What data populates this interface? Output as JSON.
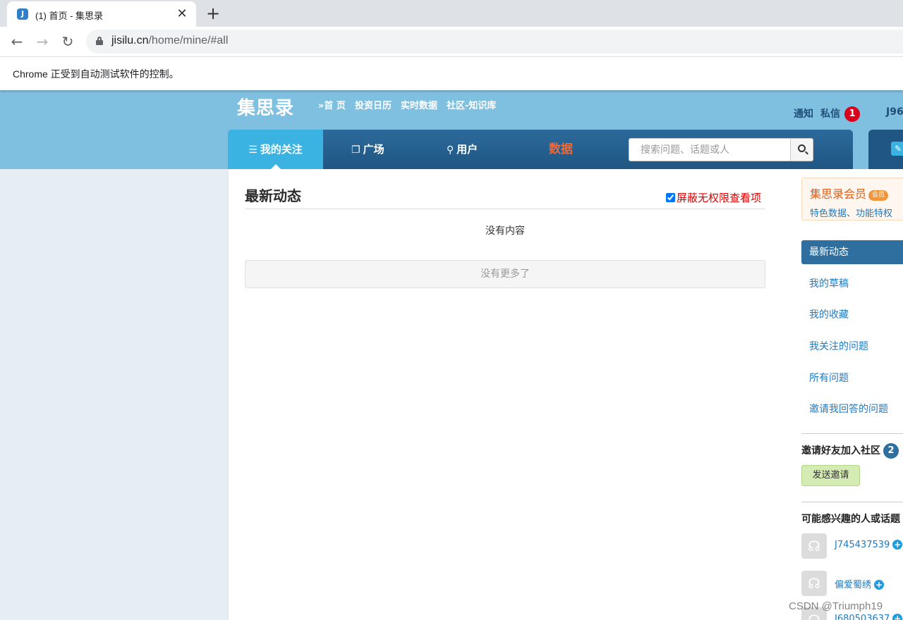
{
  "browser": {
    "tab_title": "(1) 首页 - 集思录",
    "url_host": "jisilu.cn",
    "url_path": "/home/mine/#all",
    "infobar_text": "Chrome 正受到自动测试软件的控制。"
  },
  "header": {
    "logo": "集思录",
    "top_nav": [
      "»首 页",
      "投资日历",
      "实时数据",
      "社区-知识库"
    ],
    "notify_label": "通知",
    "message_label": "私信",
    "message_count": "1",
    "username_short": "J96"
  },
  "main_nav": {
    "tabs": [
      {
        "label": "我的关注",
        "icon": "list-icon",
        "active": true
      },
      {
        "label": "广场",
        "icon": "copy-icon"
      },
      {
        "label": "用户",
        "icon": "user-icon"
      },
      {
        "label": "数据",
        "color": "#f06a38"
      }
    ],
    "search_placeholder": "搜索问题、话题或人"
  },
  "content": {
    "title": "最新动态",
    "filter_label": "屏蔽无权限查看项",
    "filter_checked": true,
    "empty_text": "没有内容",
    "more_button": "没有更多了"
  },
  "sidebar": {
    "vip_title": "集思录会员",
    "vip_tag": "会员",
    "vip_sub": "特色数据、功能特权",
    "menu": [
      "最新动态",
      "我的草稿",
      "我的收藏",
      "我关注的问题",
      "所有问题",
      "邀请我回答的问题"
    ],
    "invite_title": "邀请好友加入社区",
    "invite_count": "2",
    "invite_button": "发送邀请",
    "recommend_title": "可能感兴趣的人或话题",
    "recommend": [
      "J745437539",
      "偏爱蜀绣",
      "J680503637"
    ]
  },
  "watermark": "CSDN @Triumph19",
  "colors": {
    "header_bg": "#7fbfe0",
    "nav_bg": "#1f5683",
    "nav_active": "#3ab3e3",
    "link": "#1f7ac0",
    "alert_red": "#e20000"
  }
}
